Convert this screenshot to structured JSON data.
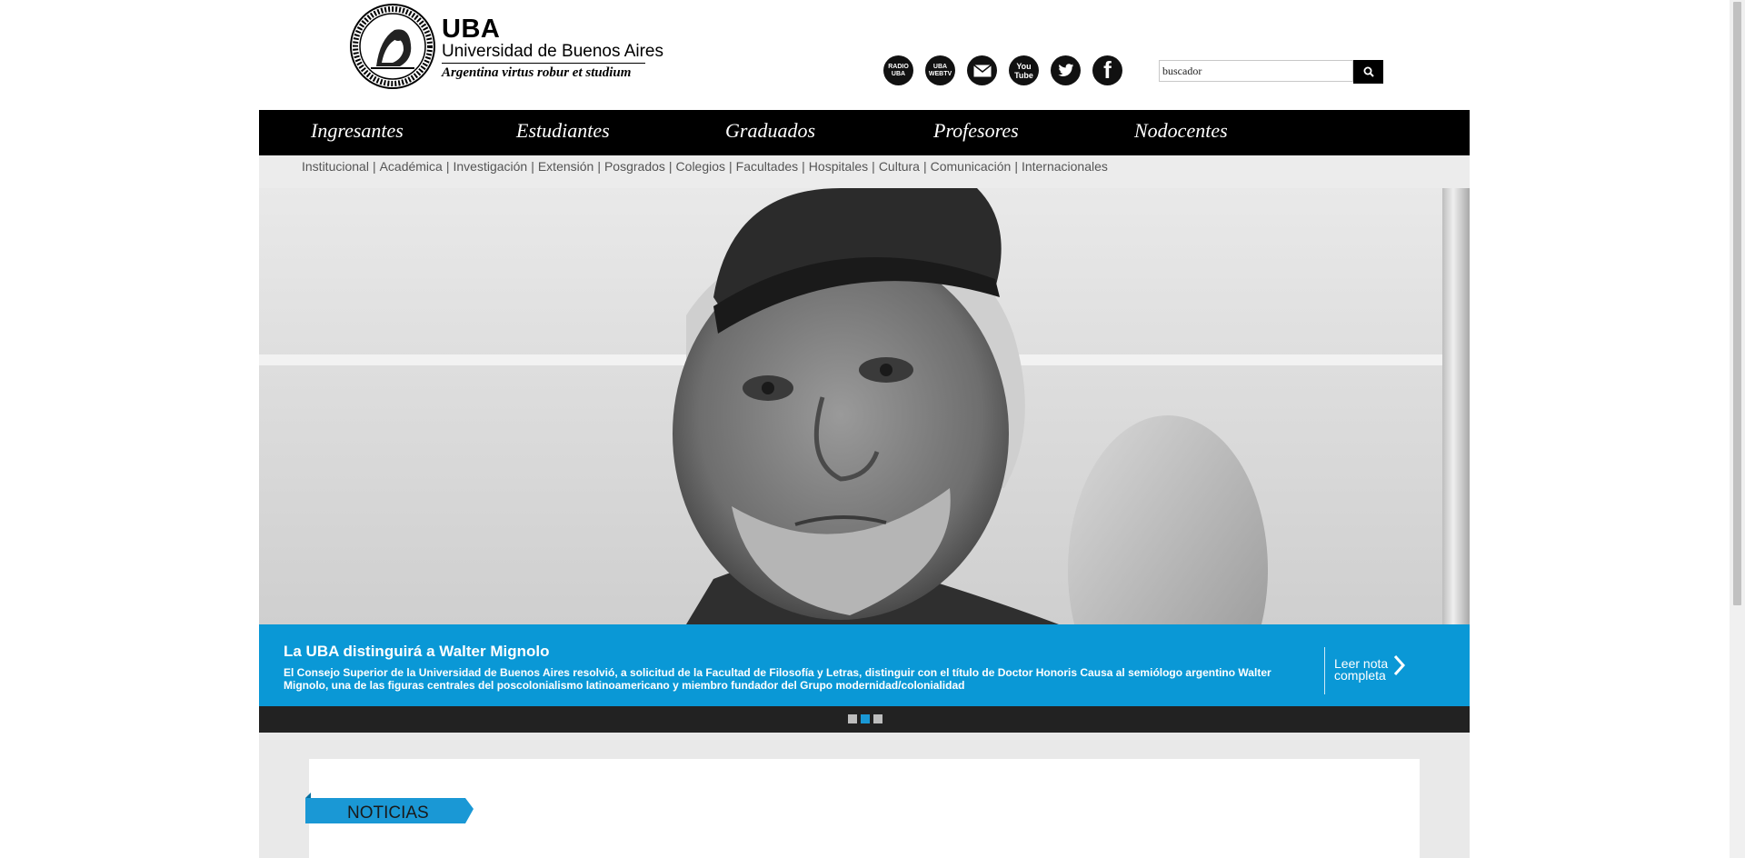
{
  "header": {
    "logo": {
      "abbr": "UBA",
      "name": "Universidad de Buenos Aires",
      "motto": "Argentina virtus robur et studium",
      "seal_text": "UNIVERSIDAD DE BUENOS AIRES"
    },
    "social": [
      {
        "icon": "radio-uba-icon",
        "text": "RADIO UBA"
      },
      {
        "icon": "uba-webtv-icon",
        "text": "UBA WEBTV"
      },
      {
        "icon": "email-icon",
        "text": ""
      },
      {
        "icon": "youtube-icon",
        "text": "You Tube"
      },
      {
        "icon": "twitter-icon",
        "text": ""
      },
      {
        "icon": "facebook-icon",
        "text": "f"
      }
    ],
    "search": {
      "value": "buscador",
      "button_icon": "search-icon"
    }
  },
  "main_nav": [
    "Ingresantes",
    "Estudiantes",
    "Graduados",
    "Profesores",
    "Nodocentes"
  ],
  "sub_nav": [
    "Institucional",
    "Académica",
    "Investigación",
    "Extensión",
    "Posgrados",
    "Colegios",
    "Facultades",
    "Hospitales",
    "Cultura",
    "Comunicación",
    "Internacionales"
  ],
  "slider": {
    "title": "La UBA distinguirá a Walter Mignolo",
    "description": "El Consejo Superior de la Universidad de Buenos Aires resolvió, a solicitud de la Facultad de Filosofía y Letras, distinguir con el título de Doctor Honoris Causa al semiólogo argentino Walter Mignolo, una de las figuras centrales del poscolonialismo latinoamericano y miembro fundador del Grupo modernidad/colonialidad",
    "read_more_line1": "Leer nota",
    "read_more_line2": "completa",
    "slide_count": 3,
    "active_slide": 2
  },
  "news": {
    "label": "NOTICIAS"
  },
  "colors": {
    "nav": "#000000",
    "accent_blue": "#0a98d6",
    "subnav_bg": "#ececec"
  }
}
